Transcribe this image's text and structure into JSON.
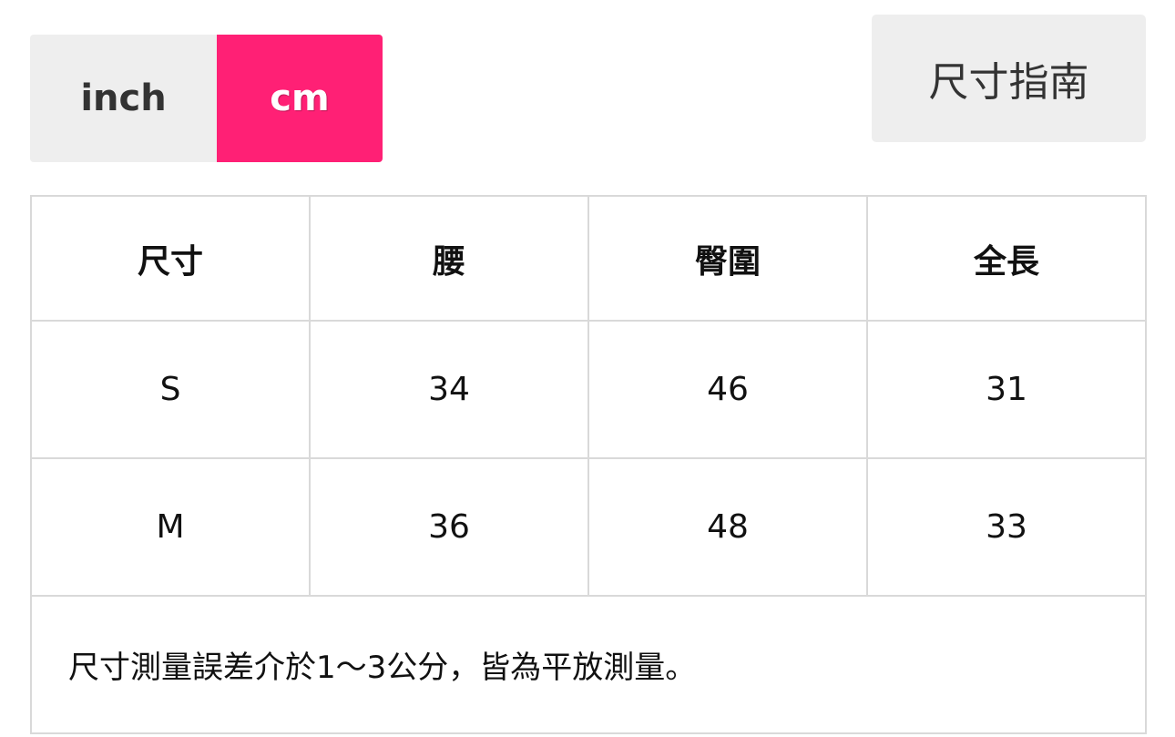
{
  "unit_toggle": {
    "options": [
      {
        "label": "inch",
        "selected": false
      },
      {
        "label": "cm",
        "selected": true
      }
    ],
    "active_color": "#ff2075",
    "inactive_color": "#eeeeee"
  },
  "guide_button": {
    "label": "尺寸指南"
  },
  "size_table": {
    "headers": [
      "尺寸",
      "腰",
      "臀圍",
      "全長"
    ],
    "rows": [
      [
        "S",
        "34",
        "46",
        "31"
      ],
      [
        "M",
        "36",
        "48",
        "33"
      ]
    ],
    "note": "尺寸測量誤差介於1～3公分，皆為平放測量。"
  }
}
